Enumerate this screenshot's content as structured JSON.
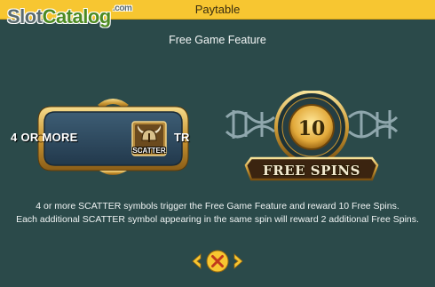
{
  "header": {
    "title": "Paytable",
    "bar_color": "#f7c631"
  },
  "watermark": {
    "part1": "Slot",
    "part2": "Catalog",
    "suffix": ".com"
  },
  "section": {
    "title": "Free Game Feature"
  },
  "plaque": {
    "text": "4 OR MORE",
    "text_tail": "TR",
    "symbol_name": "SCATTER",
    "symbol_icon": "scatter-symbol-icon"
  },
  "badge": {
    "number": "10",
    "label": "FREE SPINS",
    "icon": "free-spins-badge-icon"
  },
  "description": {
    "line1": "4 or more SCATTER symbols trigger the Free Game Feature and reward 10 Free Spins.",
    "line2": "Each additional SCATTER symbol appearing in the same spin will reward 2 additional Free Spins."
  },
  "navigation": {
    "prev_icon": "chevron-left-icon",
    "close_icon": "close-icon",
    "next_icon": "chevron-right-icon",
    "accent": "#f7c631"
  },
  "colors": {
    "background": "#2b4a4a",
    "gold": "#e0b04a",
    "text": "#f0f4f4"
  }
}
